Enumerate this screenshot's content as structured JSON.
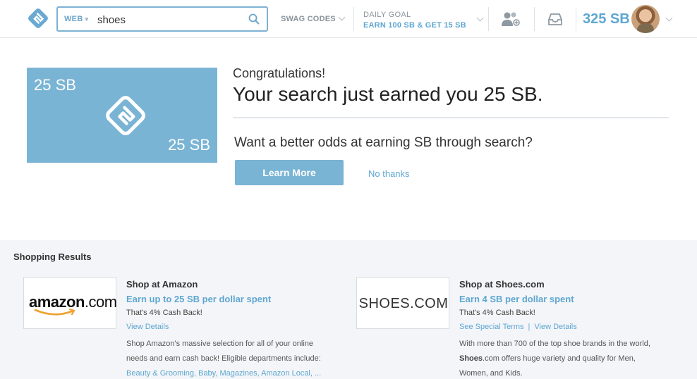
{
  "header": {
    "search": {
      "scope": "WEB",
      "query": "shoes"
    },
    "swag_codes": "SWAG CODES",
    "daily_goal": {
      "label": "DAILY GOAL",
      "value": "EARN 100 SB & GET 15 SB"
    },
    "balance": "325 SB"
  },
  "banner": {
    "card_amount_top": "25 SB",
    "card_amount_bottom": "25 SB",
    "congrats": "Congratulations!",
    "headline": "Your search just earned you 25 SB.",
    "question": "Want a better odds at earning SB through search?",
    "learn_more": "Learn More",
    "no_thanks": "No thanks"
  },
  "shopping": {
    "title": "Shopping Results",
    "offers": [
      {
        "logo_text_a": "amazon",
        "logo_text_b": ".com",
        "name": "Shop at Amazon",
        "earn": "Earn up to 25 SB per dollar spent",
        "cashback": "That's 4% Cash Back!",
        "link1": "View Details",
        "desc1": "Shop Amazon's massive selection for all of your online",
        "desc2": "needs and earn cash back! Eligible departments include:",
        "desc3": "Beauty & Grooming, Baby, Magazines, Amazon Local, ..."
      },
      {
        "logo_text": "SHOES.COM",
        "name": "Shop at Shoes.com",
        "earn": "Earn 4 SB per dollar spent",
        "cashback": "That's 4% Cash Back!",
        "link1": "See Special Terms",
        "link_sep": "|",
        "link2": "View Details",
        "desc1": "With more than 700 of the top shoe brands in the world,",
        "desc2_bold": "Shoes",
        "desc2_rest": ".com offers huge variety and quality for Men,",
        "desc3": "Women, and Kids."
      }
    ]
  },
  "colors": {
    "accent": "#5ea6d2",
    "card": "#7ab4d4",
    "shopping_bg": "#f3f5f8"
  },
  "icons": [
    "swagbucks-logo-icon",
    "search-icon",
    "chevron-down-icon",
    "friends-icon",
    "inbox-icon",
    "avatar"
  ]
}
